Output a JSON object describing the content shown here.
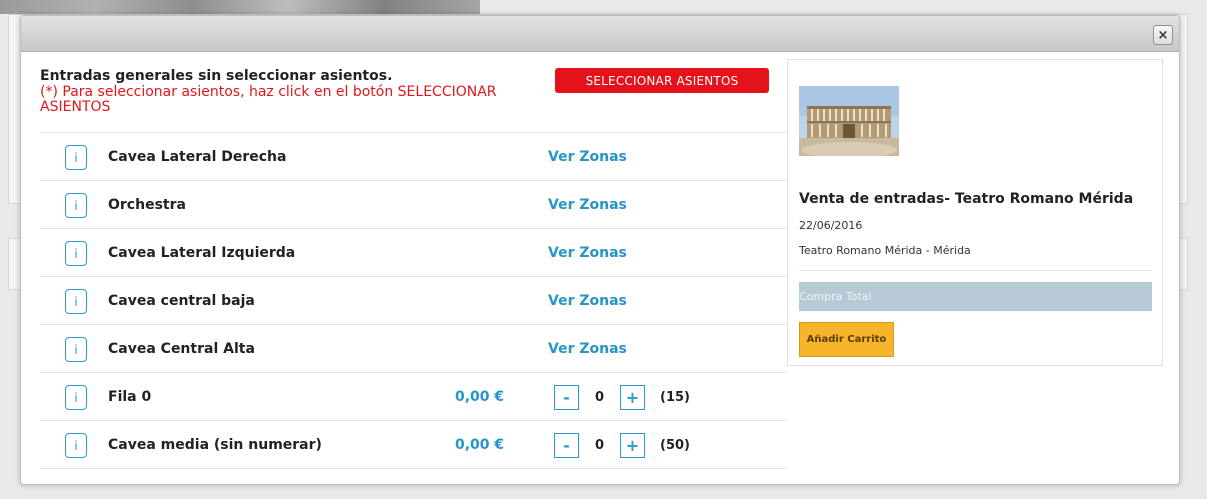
{
  "modal": {
    "close_label": "×"
  },
  "intro": {
    "title": "Entradas generales sin seleccionar asientos.",
    "note": "(*) Para seleccionar asientos, haz click en el botón SELECCIONAR ASIENTOS"
  },
  "select_seats_button": "SELECCIONAR ASIENTOS",
  "info_label": "i",
  "zones": [
    {
      "name": "Cavea Lateral Derecha",
      "link": "Ver Zonas"
    },
    {
      "name": "Orchestra",
      "link": "Ver Zonas"
    },
    {
      "name": "Cavea Lateral Izquierda",
      "link": "Ver Zonas"
    },
    {
      "name": "Cavea central baja",
      "link": "Ver Zonas"
    },
    {
      "name": "Cavea Central Alta",
      "link": "Ver Zonas"
    }
  ],
  "priced": [
    {
      "name": "Fila 0",
      "price": "0,00 €",
      "minus": "-",
      "qty": "0",
      "plus": "+",
      "avail": "(15)"
    },
    {
      "name": "Cavea media (sin numerar)",
      "price": "0,00 €",
      "minus": "-",
      "qty": "0",
      "plus": "+",
      "avail": "(50)"
    }
  ],
  "event": {
    "title": "Venta de entradas- Teatro Romano Mérida",
    "date": "22/06/2016",
    "place": "Teatro Romano Mérida - Mérida",
    "total_label": "Compra Total",
    "cart_button": "Añadir Carrito"
  },
  "colors": {
    "accent_red": "#e3121b",
    "link_blue": "#2795c9",
    "cart_yellow": "#f7b52c",
    "total_bar": "#b7c9d4"
  },
  "icons": {
    "close": "close-icon",
    "info": "info-icon",
    "event_image": "roman-theatre-photo"
  }
}
